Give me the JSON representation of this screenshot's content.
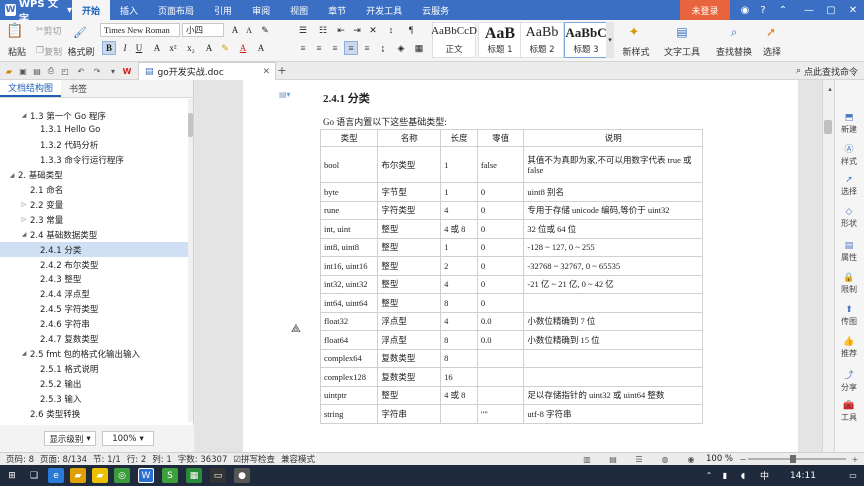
{
  "app": {
    "name": "WPS 文字",
    "login": "未登录"
  },
  "menu_tabs": [
    "开始",
    "插入",
    "页面布局",
    "引用",
    "审阅",
    "视图",
    "章节",
    "开发工具",
    "云服务"
  ],
  "ribbon": {
    "paste": "粘贴",
    "cut": "剪切",
    "copy": "复制",
    "format_painter": "格式刷",
    "font_name": "Times New Roman",
    "font_size": "小四",
    "styles": [
      {
        "preview": "AaBbCcD",
        "label": "正文"
      },
      {
        "preview": "AaB",
        "label": "标题 1"
      },
      {
        "preview": "AaBb",
        "label": "标题 2"
      },
      {
        "preview": "AaBbC",
        "label": "标题 3"
      }
    ],
    "new_style": "新样式",
    "text_tools": "文字工具",
    "find_replace": "查找替换",
    "select": "选择"
  },
  "doc_tab": {
    "filename": "go开发实战.doc"
  },
  "command_search": "点此查找命令",
  "nav": {
    "tabs": [
      "文档结构图",
      "书签"
    ],
    "items": [
      {
        "label": "1.3 第一个 Go 程序",
        "level": 1,
        "expanded": true
      },
      {
        "label": "1.3.1 Hello Go",
        "level": 2
      },
      {
        "label": "1.3.2 代码分析",
        "level": 2
      },
      {
        "label": "1.3.3 命令行运行程序",
        "level": 2
      },
      {
        "label": "2. 基础类型",
        "level": 0,
        "expanded": true
      },
      {
        "label": "2.1 命名",
        "level": 1
      },
      {
        "label": "2.2 变量",
        "level": 1,
        "collapsed": true
      },
      {
        "label": "2.3 常量",
        "level": 1,
        "collapsed": true
      },
      {
        "label": "2.4 基础数据类型",
        "level": 1,
        "expanded": true
      },
      {
        "label": "2.4.1 分类",
        "level": 2,
        "selected": true
      },
      {
        "label": "2.4.2 布尔类型",
        "level": 2
      },
      {
        "label": "2.4.3 整型",
        "level": 2
      },
      {
        "label": "2.4.4 浮点型",
        "level": 2
      },
      {
        "label": "2.4.5 字符类型",
        "level": 2
      },
      {
        "label": "2.4.6 字符串",
        "level": 2
      },
      {
        "label": "2.4.7 复数类型",
        "level": 2
      },
      {
        "label": "2.5 fmt 包的格式化输出输入",
        "level": 1,
        "expanded": true
      },
      {
        "label": "2.5.1 格式说明",
        "level": 2
      },
      {
        "label": "2.5.2 输出",
        "level": 2
      },
      {
        "label": "2.5.3 输入",
        "level": 2
      },
      {
        "label": "2.6 类型转换",
        "level": 1
      }
    ],
    "level_select": "显示级别",
    "zoom_select": "100%"
  },
  "document": {
    "heading": "2.4.1  分类",
    "intro": "Go 语言内置以下这些基础类型:"
  },
  "chart_data": {
    "type": "table",
    "columns": [
      "类型",
      "名称",
      "长度",
      "零值",
      "说明"
    ],
    "rows": [
      [
        "bool",
        "布尔类型",
        "1",
        "false",
        "其值不为真即为家,不可以用数字代表 true 或 false"
      ],
      [
        "byte",
        "字节型",
        "1",
        "0",
        "uint8 别名"
      ],
      [
        "rune",
        "字符类型",
        "4",
        "0",
        "专用于存储 unicode 编码,等价于 uint32"
      ],
      [
        "int, uint",
        "整型",
        "4 或 8",
        "0",
        "32 位或 64 位"
      ],
      [
        "int8, uint8",
        "整型",
        "1",
        "0",
        "-128 ~ 127, 0 ~ 255"
      ],
      [
        "int16, uint16",
        "整型",
        "2",
        "0",
        "-32768 ~ 32767, 0 ~ 65535"
      ],
      [
        "int32, uint32",
        "整型",
        "4",
        "0",
        "-21 亿 ~ 21 亿, 0 ~ 42 亿"
      ],
      [
        "int64, uint64",
        "整型",
        "8",
        "0",
        ""
      ],
      [
        "float32",
        "浮点型",
        "4",
        "0.0",
        "小数位精确到 7 位"
      ],
      [
        "float64",
        "浮点型",
        "8",
        "0.0",
        "小数位精确到 15 位"
      ],
      [
        "complex64",
        "复数类型",
        "8",
        "",
        ""
      ],
      [
        "complex128",
        "复数类型",
        "16",
        "",
        ""
      ],
      [
        "uintptr",
        "整型",
        "4 或 8",
        "",
        "足以存储指针的 uint32 或 uint64 整数"
      ],
      [
        "string",
        "字符串",
        "",
        "\"\"",
        "utf-8 字符串"
      ]
    ]
  },
  "side_panel": [
    "新建",
    "样式",
    "选择",
    "形状",
    "属性",
    "限制",
    "传图",
    "推荐",
    "分享",
    "工具"
  ],
  "status": {
    "page_num": "页码: 8",
    "page": "页面: 8/134",
    "section": "节: 1/1",
    "row": "行: 2",
    "col": "列: 1",
    "words": "字数: 36307",
    "spell": "拼写检查",
    "compat": "兼容模式",
    "zoom": "100 %"
  },
  "taskbar": {
    "ime": "中",
    "time": "14:11"
  },
  "colors": {
    "accent": "#3a6fc4",
    "login": "#e8643c",
    "selection": "#cfe0f4"
  }
}
